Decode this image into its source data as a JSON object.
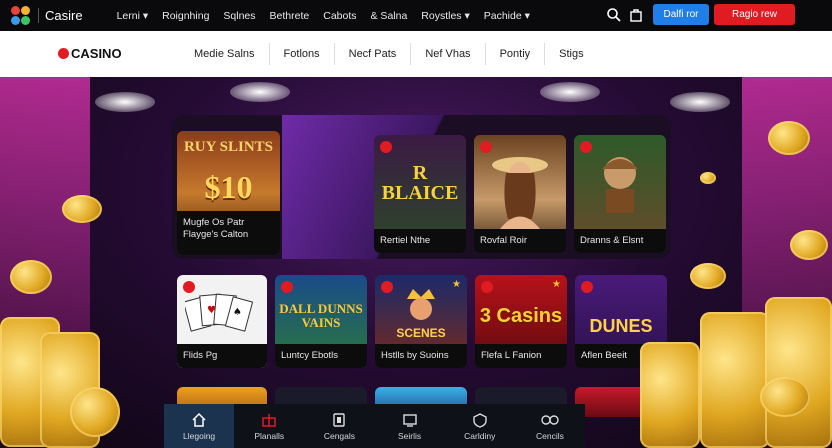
{
  "topbar": {
    "brand": "Casire",
    "nav": [
      "Lerni ▾",
      "Roignhing",
      "Sqlnes",
      "Bethrete",
      "Cabots",
      "& Salna",
      "Roystles ▾",
      "Pachide ▾"
    ],
    "login_label": "Dalfi ror",
    "register_label": "Ragio rew"
  },
  "subbar": {
    "logo": "CASINO",
    "nav": [
      "Medie Salns",
      "Fotlons",
      "Necf Pats",
      "Nef Vhas",
      "Pontiy",
      "Stigs"
    ]
  },
  "hero": {
    "feature_title": "RUY SLINTS",
    "feature_amount": "$10",
    "feature_caption": "Mugfe Os Patr Flayge's Calton",
    "tiles": [
      {
        "art": "R BLAICE",
        "caption": "Rertiel Nthe"
      },
      {
        "art": "",
        "caption": "Rovfal Roir"
      },
      {
        "art": "",
        "caption": "Dranns & Elsnt"
      }
    ]
  },
  "grid": [
    {
      "art": "",
      "caption": "Flids Pg"
    },
    {
      "art": "DALL DUNNS VAINS",
      "caption": "Luntcy Ebotls"
    },
    {
      "art": "SCENES",
      "caption": "Hstlls by Suoins"
    },
    {
      "art": "3 Casins",
      "caption": "Flefa L Fanion"
    },
    {
      "art": "DUNES",
      "caption": "Aflen Beeit"
    }
  ],
  "bottomnav": [
    {
      "label": "Llegoing",
      "icon": "home-icon"
    },
    {
      "label": "Planalls",
      "icon": "gift-icon"
    },
    {
      "label": "Cengals",
      "icon": "cards-icon"
    },
    {
      "label": "Seirlis",
      "icon": "screen-icon"
    },
    {
      "label": "Carldiny",
      "icon": "shield-icon"
    },
    {
      "label": "Cencils",
      "icon": "link-icon"
    }
  ],
  "colors": {
    "accent_blue": "#1f7ee8",
    "accent_red": "#e11b22",
    "gold": "#e0a821"
  }
}
